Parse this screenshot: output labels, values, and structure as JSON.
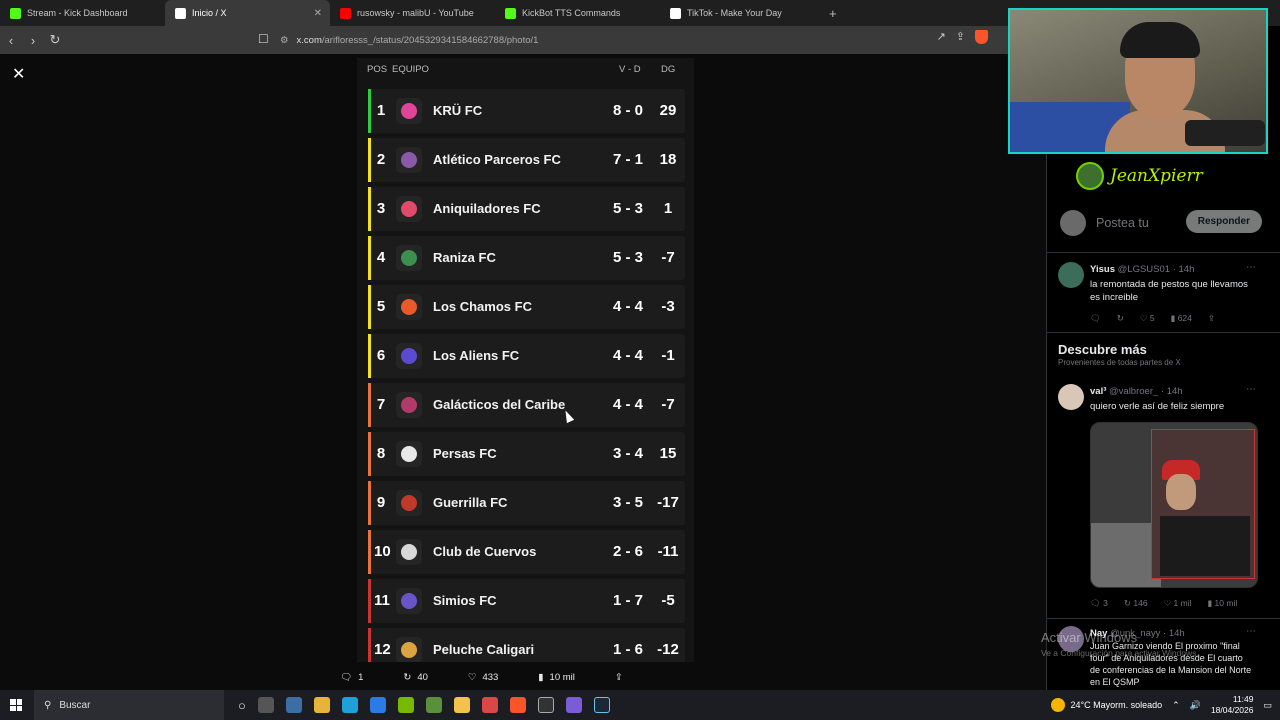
{
  "browser": {
    "tabs": [
      {
        "label": "Stream - Kick Dashboard",
        "color": "#53fc18",
        "active": false
      },
      {
        "label": "Inicio / X",
        "color": "#ffffff",
        "active": true
      },
      {
        "label": "rusowsky - malibU - YouTube",
        "color": "#ff0000",
        "active": false
      },
      {
        "label": "KickBot TTS Commands",
        "color": "#53fc18",
        "active": false
      },
      {
        "label": "TikTok - Make Your Day",
        "color": "#ffffff",
        "active": false
      }
    ],
    "new_tab": "+",
    "url_domain": "x.com",
    "url_path": "/arifloresss_/status/2045329341584662788/photo/1"
  },
  "standings": {
    "headers": {
      "pos": "POS",
      "team": "EQUIPO",
      "vd": "V - D",
      "dg": "DG"
    },
    "rows": [
      {
        "pos": "1",
        "team": "KRÜ FC",
        "vd": "8 - 0",
        "dg": "29",
        "bar": "#2ecc40",
        "logo": "#e0459a"
      },
      {
        "pos": "2",
        "team": "Atlético Parceros FC",
        "vd": "7 - 1",
        "dg": "18",
        "bar": "#f5e11a",
        "logo": "#8a5aa8"
      },
      {
        "pos": "3",
        "team": "Aniquiladores FC",
        "vd": "5 - 3",
        "dg": "1",
        "bar": "#f5e11a",
        "logo": "#e14b6a"
      },
      {
        "pos": "4",
        "team": "Raniza FC",
        "vd": "5 - 3",
        "dg": "-7",
        "bar": "#f5e11a",
        "logo": "#3c8f4f"
      },
      {
        "pos": "5",
        "team": "Los Chamos FC",
        "vd": "4 - 4",
        "dg": "-3",
        "bar": "#f5e11a",
        "logo": "#e85a2a"
      },
      {
        "pos": "6",
        "team": "Los Aliens FC",
        "vd": "4 - 4",
        "dg": "-1",
        "bar": "#f5e11a",
        "logo": "#5b4bd3"
      },
      {
        "pos": "7",
        "team": "Galácticos del Caribe",
        "vd": "4 - 4",
        "dg": "-7",
        "bar": "#e8743a",
        "logo": "#b13a6b"
      },
      {
        "pos": "8",
        "team": "Persas FC",
        "vd": "3 - 4",
        "dg": "15",
        "bar": "#e8743a",
        "logo": "#e8e8e8"
      },
      {
        "pos": "9",
        "team": "Guerrilla FC",
        "vd": "3 - 5",
        "dg": "-17",
        "bar": "#e8743a",
        "logo": "#c0392b"
      },
      {
        "pos": "10",
        "team": "Club de Cuervos",
        "vd": "2 - 6",
        "dg": "-11",
        "bar": "#e8743a",
        "logo": "#d8d8d8"
      },
      {
        "pos": "11",
        "team": "Simios FC",
        "vd": "1 - 7",
        "dg": "-5",
        "bar": "#cc3333",
        "logo": "#6a55c8"
      },
      {
        "pos": "12",
        "team": "Peluche Caligari",
        "vd": "1 - 6",
        "dg": "-12",
        "bar": "#cc3333",
        "logo": "#d9a441"
      }
    ]
  },
  "post_actions": {
    "replies": "1",
    "reposts": "40",
    "likes": "433",
    "views": "10 mil"
  },
  "sidebar": {
    "streamer_name": "JeanXpierr",
    "reply_placeholder": "Postea tu",
    "reply_button": "Responder",
    "tweet1": {
      "name": "Yisus",
      "handle": "@LGSUS01 · 14h",
      "text": "la remontada de pestos que llevamos es increible",
      "stats": [
        "624"
      ],
      "likes": "5"
    },
    "discover_title": "Descubre más",
    "discover_sub": "Provenientes de todas partes de X",
    "tweet2": {
      "name": "val³",
      "handle": "@valbroer_ · 14h",
      "text": "quiero verle así de feliz siempre",
      "replies": "3",
      "reposts": "146",
      "likes": "1 mil",
      "views": "10 mil"
    },
    "tweet3": {
      "name": "Nay",
      "handle": "@unk_nayy · 14h",
      "text": "Juan Garnizo viendo El proximo \"final four\" de Aniquiladores desde El cuarto de conferencias de la Mansion del Norte en El QSMP"
    }
  },
  "watermark": {
    "line1": "Activar Windows",
    "line2": "Ve a Configuración para activar Windows."
  },
  "taskbar": {
    "search": "Buscar",
    "weather": "24°C  Mayorm. soleado",
    "time": "11:49",
    "date": "18/04/2026"
  }
}
